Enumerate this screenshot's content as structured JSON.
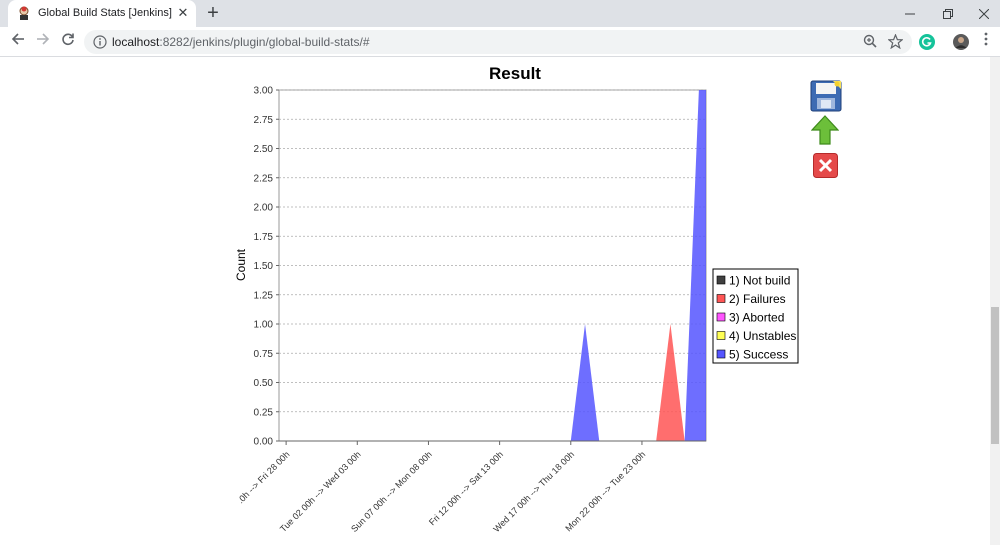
{
  "browser": {
    "tab_title": "Global Build Stats [Jenkins]",
    "tab_close_glyph": "✕",
    "new_tab_glyph": "+",
    "url_host": "localhost",
    "url_path": ":8282/jenkins/plugin/global-build-stats/#",
    "window_controls": [
      "minimize-icon",
      "restore-icon",
      "close-icon"
    ]
  },
  "page": {
    "actions": [
      {
        "name": "save-icon",
        "title": "Save"
      },
      {
        "name": "move-up-arrow-icon",
        "title": "Move up"
      },
      {
        "name": "delete-icon",
        "title": "Delete"
      }
    ]
  },
  "chart_data": {
    "type": "area",
    "title": "Result",
    "xlabel": "",
    "ylabel": "Count",
    "ylim": [
      0,
      3.0
    ],
    "yticks": [
      "0.00",
      "0.25",
      "0.50",
      "0.75",
      "1.00",
      "1.25",
      "1.50",
      "1.75",
      "2.00",
      "2.25",
      "2.50",
      "2.75",
      "3.00"
    ],
    "x_tick_labels": [
      ".0h --> Fri 28 00h",
      "Tue 02 00h --> Wed 03 00h",
      "Sun 07 00h --> Mon 08 00h",
      "Fri 12 00h --> Sat 13 00h",
      "Wed 17 00h --> Thu 18 00h",
      "Mon 22 00h --> Tue 23 00h"
    ],
    "grid": true,
    "legend_position": "right",
    "colors": {
      "not_build": "#404040",
      "failures": "#ff5555",
      "aborted": "#ff55ff",
      "unstables": "#ffff55",
      "success": "#5555ff"
    },
    "legend": [
      {
        "label": "1) Not build",
        "color": "#404040"
      },
      {
        "label": "2) Failures",
        "color": "#ff5555"
      },
      {
        "label": "3) Aborted",
        "color": "#ff55ff"
      },
      {
        "label": "4) Unstables",
        "color": "#ffff55"
      },
      {
        "label": "5) Success",
        "color": "#5555ff"
      }
    ],
    "num_periods": 30,
    "series": [
      {
        "name": "5) Success",
        "color": "#5555ff",
        "spikes": [
          {
            "period": 21,
            "value": 1
          },
          {
            "period": 29,
            "value": 3
          }
        ]
      },
      {
        "name": "2) Failures",
        "color": "#ff5555",
        "spikes": [
          {
            "period": 27,
            "value": 1
          }
        ]
      }
    ]
  }
}
